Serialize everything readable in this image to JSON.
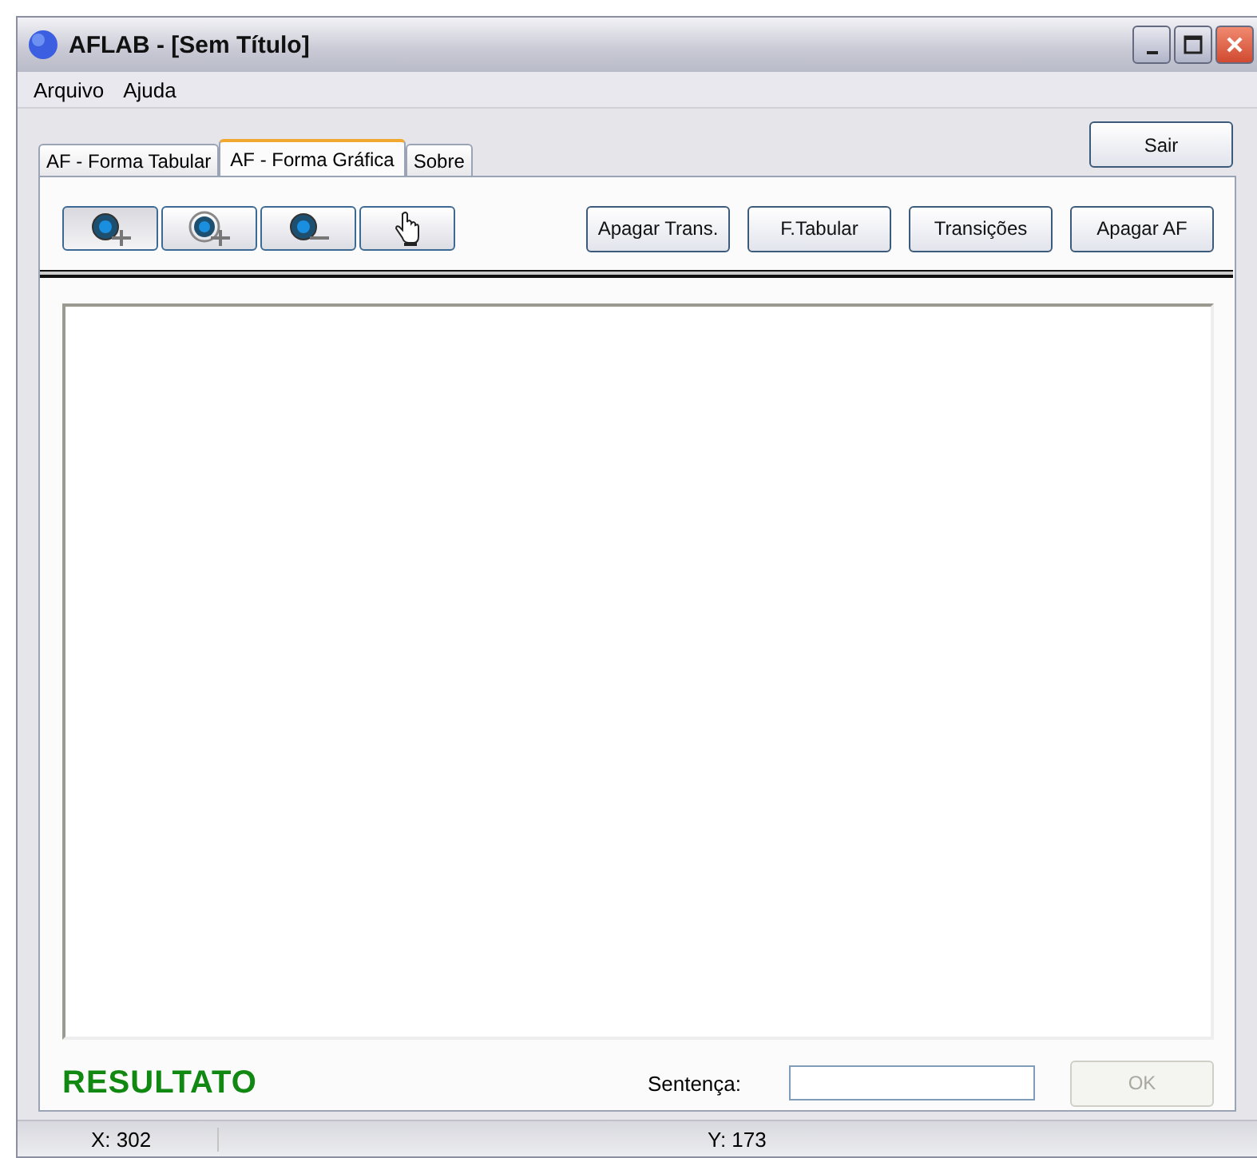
{
  "window": {
    "title": "AFLAB - [Sem Título]"
  },
  "menu": [
    "Arquivo",
    "Ajuda"
  ],
  "exit_button": "Sair",
  "tabs": [
    {
      "label": "AF - Forma Tabular",
      "selected": false
    },
    {
      "label": "AF - Forma Gráfica",
      "selected": true
    },
    {
      "label": "Sobre",
      "selected": false
    }
  ],
  "tools": [
    {
      "kind": "add-state",
      "selected": true
    },
    {
      "kind": "add-final",
      "selected": false
    },
    {
      "kind": "remove",
      "selected": false
    },
    {
      "kind": "hand",
      "selected": false
    }
  ],
  "actions": [
    "Apagar Trans.",
    "F.Tabular",
    "Transições",
    "Apagar AF"
  ],
  "result": "RESULTATO",
  "sentence": {
    "label": "Sentença:"
  },
  "ok_button": {
    "label": "OK",
    "disabled": true
  },
  "status_bar": [
    "X: 302",
    "Y: 173"
  ]
}
